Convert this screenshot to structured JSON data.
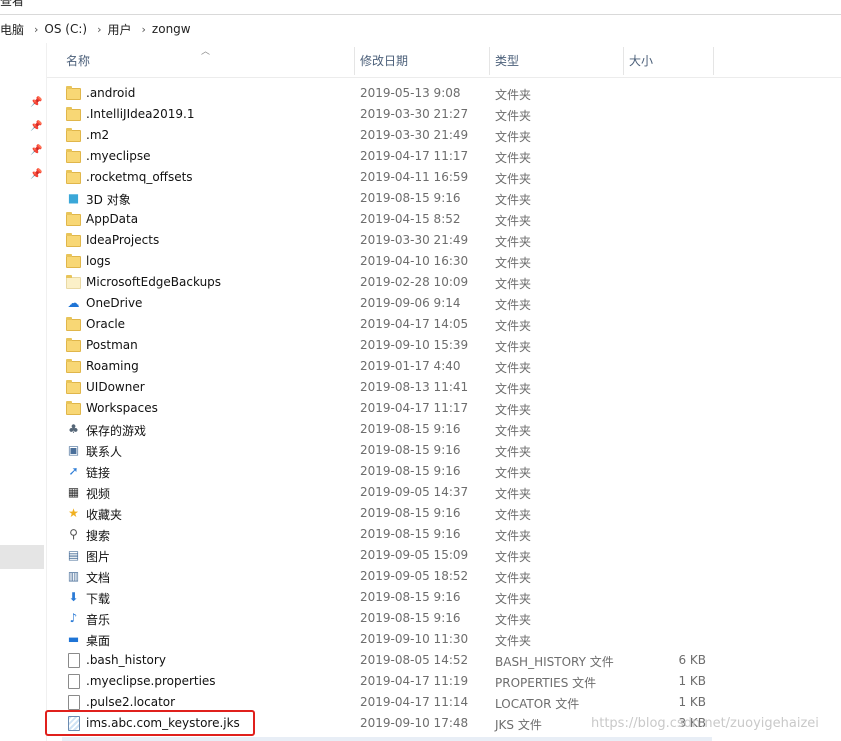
{
  "window": {
    "menu_cut_label": "查看"
  },
  "breadcrumb": [
    {
      "label": "电脑"
    },
    {
      "label": "OS (C:)"
    },
    {
      "label": "用户"
    },
    {
      "label": "zongw"
    }
  ],
  "columns": {
    "name": "名称",
    "date": "修改日期",
    "type": "类型",
    "size": "大小"
  },
  "files": [
    {
      "icon": "folder",
      "name": ".android",
      "date": "2019-05-13 9:08",
      "type": "文件夹",
      "size": ""
    },
    {
      "icon": "folder",
      "name": ".IntelliJIdea2019.1",
      "date": "2019-03-30 21:27",
      "type": "文件夹",
      "size": ""
    },
    {
      "icon": "folder",
      "name": ".m2",
      "date": "2019-03-30 21:49",
      "type": "文件夹",
      "size": ""
    },
    {
      "icon": "folder",
      "name": ".myeclipse",
      "date": "2019-04-17 11:17",
      "type": "文件夹",
      "size": ""
    },
    {
      "icon": "folder",
      "name": ".rocketmq_offsets",
      "date": "2019-04-11 16:59",
      "type": "文件夹",
      "size": ""
    },
    {
      "icon": "cube",
      "name": "3D 对象",
      "date": "2019-08-15 9:16",
      "type": "文件夹",
      "size": ""
    },
    {
      "icon": "folder",
      "name": "AppData",
      "date": "2019-04-15 8:52",
      "type": "文件夹",
      "size": ""
    },
    {
      "icon": "folder",
      "name": "IdeaProjects",
      "date": "2019-03-30 21:49",
      "type": "文件夹",
      "size": ""
    },
    {
      "icon": "folder",
      "name": "logs",
      "date": "2019-04-10 16:30",
      "type": "文件夹",
      "size": ""
    },
    {
      "icon": "folder-pale",
      "name": "MicrosoftEdgeBackups",
      "date": "2019-02-28 10:09",
      "type": "文件夹",
      "size": ""
    },
    {
      "icon": "cloud",
      "name": "OneDrive",
      "date": "2019-09-06 9:14",
      "type": "文件夹",
      "size": ""
    },
    {
      "icon": "folder",
      "name": "Oracle",
      "date": "2019-04-17 14:05",
      "type": "文件夹",
      "size": ""
    },
    {
      "icon": "folder",
      "name": "Postman",
      "date": "2019-09-10 15:39",
      "type": "文件夹",
      "size": ""
    },
    {
      "icon": "folder",
      "name": "Roaming",
      "date": "2019-01-17 4:40",
      "type": "文件夹",
      "size": ""
    },
    {
      "icon": "folder",
      "name": "UIDowner",
      "date": "2019-08-13 11:41",
      "type": "文件夹",
      "size": ""
    },
    {
      "icon": "folder",
      "name": "Workspaces",
      "date": "2019-04-17 11:17",
      "type": "文件夹",
      "size": ""
    },
    {
      "icon": "game",
      "name": "保存的游戏",
      "date": "2019-08-15 9:16",
      "type": "文件夹",
      "size": ""
    },
    {
      "icon": "contacts",
      "name": "联系人",
      "date": "2019-08-15 9:16",
      "type": "文件夹",
      "size": ""
    },
    {
      "icon": "link",
      "name": "链接",
      "date": "2019-08-15 9:16",
      "type": "文件夹",
      "size": ""
    },
    {
      "icon": "video",
      "name": "视频",
      "date": "2019-09-05 14:37",
      "type": "文件夹",
      "size": ""
    },
    {
      "icon": "star",
      "name": "收藏夹",
      "date": "2019-08-15 9:16",
      "type": "文件夹",
      "size": ""
    },
    {
      "icon": "search",
      "name": "搜索",
      "date": "2019-08-15 9:16",
      "type": "文件夹",
      "size": ""
    },
    {
      "icon": "picture",
      "name": "图片",
      "date": "2019-09-05 15:09",
      "type": "文件夹",
      "size": ""
    },
    {
      "icon": "document",
      "name": "文档",
      "date": "2019-09-05 18:52",
      "type": "文件夹",
      "size": ""
    },
    {
      "icon": "download",
      "name": "下载",
      "date": "2019-08-15 9:16",
      "type": "文件夹",
      "size": ""
    },
    {
      "icon": "music",
      "name": "音乐",
      "date": "2019-08-15 9:16",
      "type": "文件夹",
      "size": ""
    },
    {
      "icon": "desktop",
      "name": "桌面",
      "date": "2019-09-10 11:30",
      "type": "文件夹",
      "size": ""
    },
    {
      "icon": "file",
      "name": ".bash_history",
      "date": "2019-08-05 14:52",
      "type": "BASH_HISTORY 文件",
      "size": "6 KB"
    },
    {
      "icon": "file",
      "name": ".myeclipse.properties",
      "date": "2019-04-17 11:19",
      "type": "PROPERTIES 文件",
      "size": "1 KB"
    },
    {
      "icon": "file",
      "name": ".pulse2.locator",
      "date": "2019-04-17 11:14",
      "type": "LOCATOR 文件",
      "size": "1 KB"
    },
    {
      "icon": "jks",
      "name": "ims.abc.com_keystore.jks",
      "date": "2019-09-10 17:48",
      "type": "JKS 文件",
      "size": "3 KB"
    }
  ],
  "watermark": "https://blog.csdn.net/zuoyigehaizei",
  "colors": {
    "folder": "#f8d775",
    "highlight": "#e0201c",
    "header_text": "#4c607a"
  }
}
